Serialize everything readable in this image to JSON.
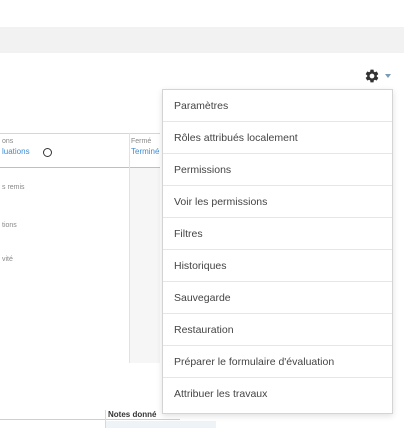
{
  "menu": {
    "items": [
      {
        "label": "Paramètres"
      },
      {
        "label": "Rôles attribués localement"
      },
      {
        "label": "Permissions"
      },
      {
        "label": "Voir les permissions"
      },
      {
        "label": "Filtres"
      },
      {
        "label": "Historiques"
      },
      {
        "label": "Sauvegarde"
      },
      {
        "label": "Restauration"
      },
      {
        "label": "Préparer le formulaire d'évaluation"
      },
      {
        "label": "Attribuer les travaux"
      }
    ]
  },
  "table": {
    "col1_header": "ons",
    "col1_link": "luations",
    "col2_header": "Fermé",
    "col2_link": "Terminé",
    "rows": [
      "s remis",
      "tions",
      "vité"
    ]
  },
  "footer": {
    "notes_label": "Notes donné"
  },
  "colors": {
    "link": "#3b8ed6",
    "topbar": "#f2f2f2",
    "caret": "#7a9bb8"
  },
  "icons": {
    "settings": "gear-icon",
    "dropdown": "caret-down-icon",
    "status": "circle-icon"
  }
}
